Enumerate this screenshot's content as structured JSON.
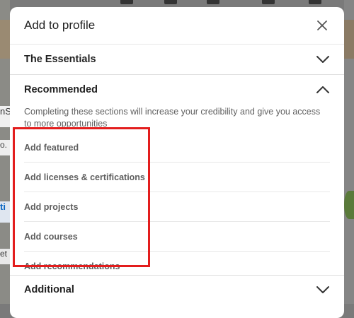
{
  "modal": {
    "title": "Add to profile"
  },
  "sections": {
    "essentials": {
      "title": "The Essentials",
      "expanded": false
    },
    "recommended": {
      "title": "Recommended",
      "expanded": true,
      "description": "Completing these sections will increase your credibility and give you access to more opportunities",
      "items": [
        {
          "label": "Add featured"
        },
        {
          "label": "Add licenses & certifications"
        },
        {
          "label": "Add projects"
        },
        {
          "label": "Add courses"
        },
        {
          "label": "Add recommendations"
        }
      ]
    },
    "additional": {
      "title": "Additional",
      "expanded": false
    }
  },
  "background_fragments": {
    "left_1": "nS",
    "left_2": "o.",
    "left_3": "ti",
    "left_4": "et"
  },
  "colors": {
    "highlight": "#e31d1d",
    "overlay": "#7a7a7a"
  },
  "icons": {
    "close": "close-icon",
    "collapse": "chevron-up-icon",
    "expand": "chevron-down-icon"
  }
}
